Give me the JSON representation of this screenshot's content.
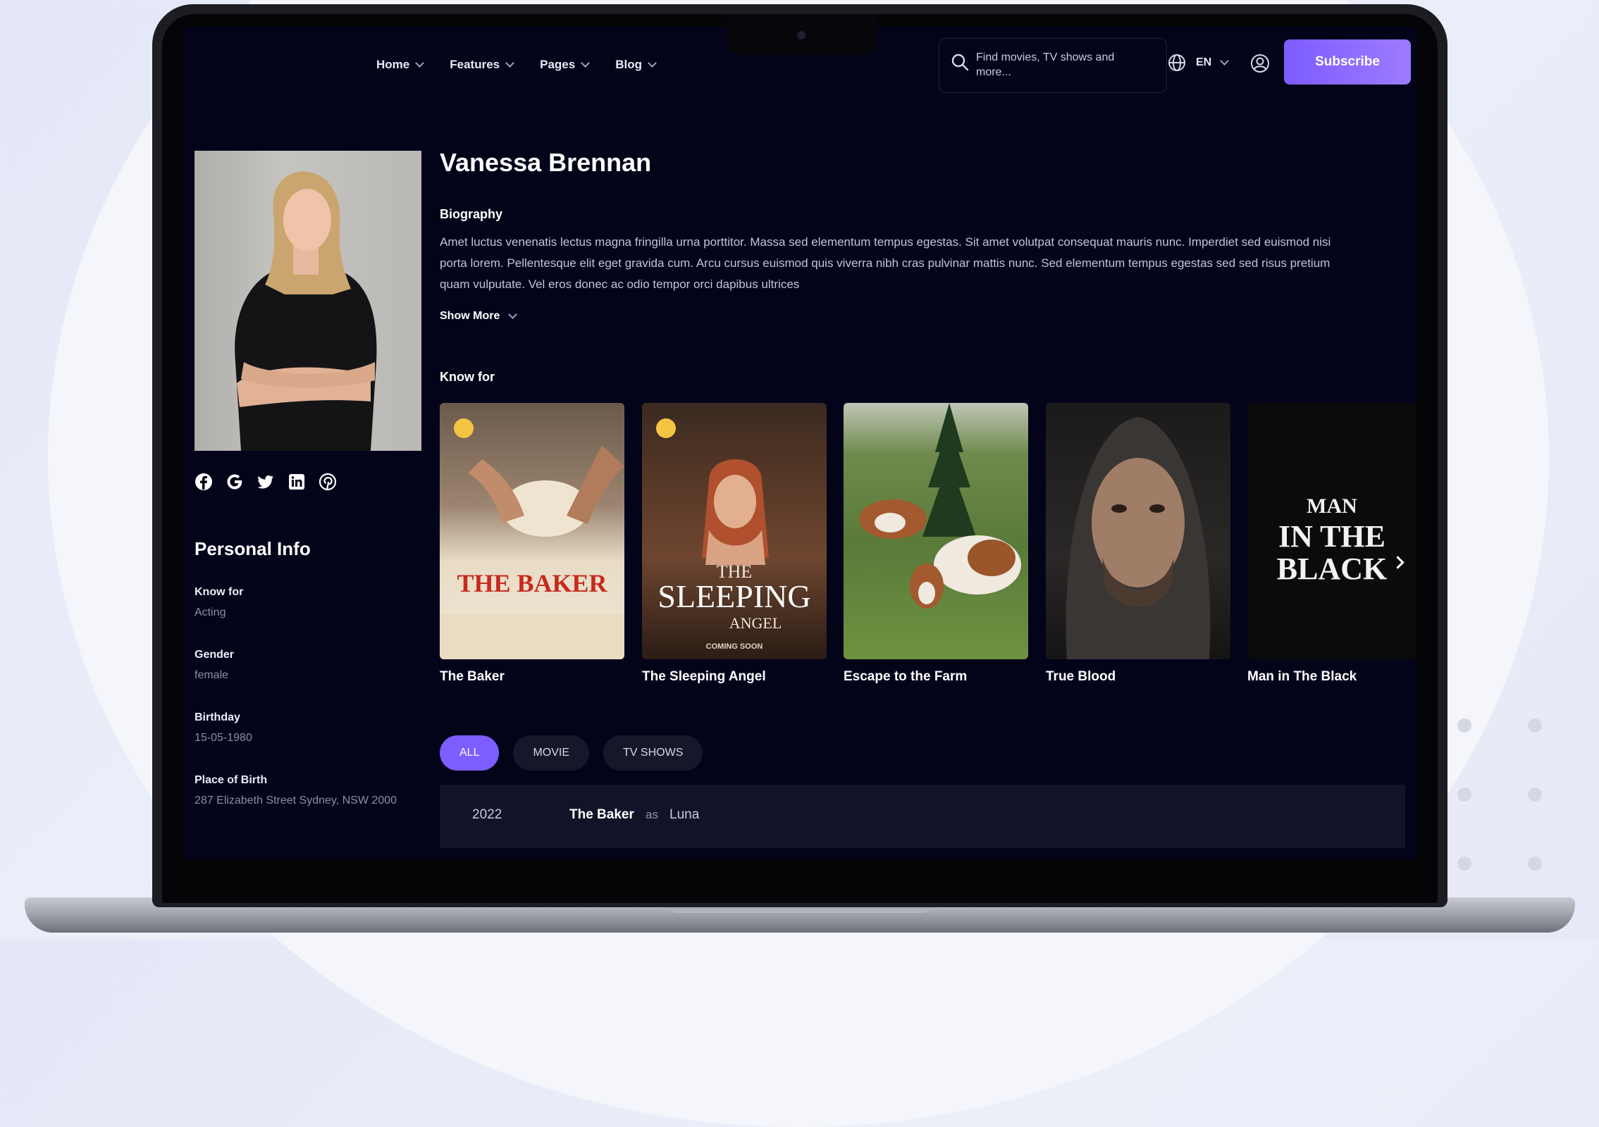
{
  "header": {
    "nav": [
      {
        "label": "Home"
      },
      {
        "label": "Features"
      },
      {
        "label": "Pages"
      },
      {
        "label": "Blog"
      }
    ],
    "search_placeholder": "Find movies, TV shows and more...",
    "language": "EN",
    "subscribe_label": "Subscribe"
  },
  "profile": {
    "name": "Vanessa Brennan",
    "biography_title": "Biography",
    "biography": "Amet luctus venenatis lectus magna fringilla urna porttitor. Massa sed elementum tempus egestas. Sit amet volutpat consequat mauris nunc. Imperdiet sed euismod nisi porta lorem. Pellentesque elit eget gravida cum. Arcu cursus euismod quis viverra nibh cras pulvinar mattis nunc. Sed elementum tempus egestas sed sed risus pretium quam vulputate. Vel eros donec ac odio tempor orci dapibus ultrices",
    "show_more": "Show More",
    "socials": [
      "facebook-icon",
      "google-icon",
      "twitter-icon",
      "linkedin-icon",
      "pinterest-icon"
    ]
  },
  "personal_info": {
    "title": "Personal Info",
    "items": [
      {
        "label": "Know for",
        "value": "Acting"
      },
      {
        "label": "Gender",
        "value": "female"
      },
      {
        "label": "Birthday",
        "value": "15-05-1980"
      },
      {
        "label": "Place of Birth",
        "value": "287 Elizabeth Street Sydney, NSW 2000"
      }
    ]
  },
  "known_for": {
    "title": "Know for",
    "items": [
      {
        "title": "The Baker",
        "poster_text": "THE BAKER"
      },
      {
        "title": "The Sleeping Angel",
        "poster_text_1": "THE",
        "poster_text_2": "SLEEPING",
        "poster_text_3": "ANGEL",
        "poster_text_4": "COMING SOON"
      },
      {
        "title": "Escape to the Farm"
      },
      {
        "title": "True Blood"
      },
      {
        "title": "Man in The Black",
        "poster_text_1": "MAN",
        "poster_text_2": "IN THE",
        "poster_text_3": "BLACK"
      }
    ]
  },
  "filters": [
    {
      "label": "ALL",
      "active": true
    },
    {
      "label": "MOVIE",
      "active": false
    },
    {
      "label": "TV SHOWS",
      "active": false
    }
  ],
  "credits": [
    {
      "year": "2022",
      "title": "The Baker",
      "as": "as",
      "role": "Luna"
    }
  ],
  "colors": {
    "background": "#03041a",
    "accent": "#7d5dff",
    "badge": "#f4c542"
  }
}
